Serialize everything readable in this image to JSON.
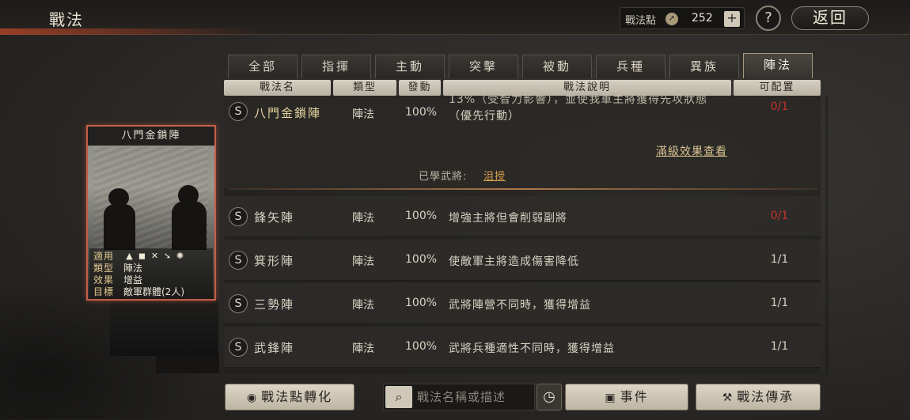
{
  "header": {
    "title": "戰法",
    "points_label": "戰法點",
    "points_value": "252",
    "plus_label": "+",
    "help_label": "?",
    "back_label": "返回"
  },
  "tabs": [
    {
      "label": "全部",
      "active": false
    },
    {
      "label": "指揮",
      "active": false
    },
    {
      "label": "主動",
      "active": false
    },
    {
      "label": "突擊",
      "active": false
    },
    {
      "label": "被動",
      "active": false
    },
    {
      "label": "兵種",
      "active": false
    },
    {
      "label": "異族",
      "active": false
    },
    {
      "label": "陣法",
      "active": true
    }
  ],
  "columns": {
    "name": "戰法名",
    "type": "類型",
    "rate": "發動",
    "desc": "戰法說明",
    "config": "可配置"
  },
  "selected": {
    "badge": "S",
    "name": "八門金鎖陣",
    "type": "陣法",
    "rate": "100%",
    "desc_partial": "13%（受智力影響），並使我軍主將獲得先攻狀態",
    "desc_line2": "（優先行動）",
    "config": "0/1",
    "detail_link": "滿級效果查看",
    "learned_label": "已學武將:",
    "learned_name": "沮授"
  },
  "rows": [
    {
      "badge": "S",
      "name": "鋒矢陣",
      "type": "陣法",
      "rate": "100%",
      "desc": "增強主將但會削弱副將",
      "config": "0/1",
      "config_state": "full"
    },
    {
      "badge": "S",
      "name": "箕形陣",
      "type": "陣法",
      "rate": "100%",
      "desc": "使敵軍主將造成傷害降低",
      "config": "1/1",
      "config_state": "ok"
    },
    {
      "badge": "S",
      "name": "三勢陣",
      "type": "陣法",
      "rate": "100%",
      "desc": "武將陣營不同時，獲得增益",
      "config": "1/1",
      "config_state": "ok"
    },
    {
      "badge": "S",
      "name": "武鋒陣",
      "type": "陣法",
      "rate": "100%",
      "desc": "武將兵種適性不同時，獲得增益",
      "config": "1/1",
      "config_state": "ok"
    }
  ],
  "card": {
    "title": "八門金鎖陣",
    "applies_key": "適用",
    "applies_icons": [
      "shield-icon",
      "crossbow-icon",
      "spear-icon",
      "cavalry-icon",
      "siege-icon"
    ],
    "type_key": "類型",
    "type_val": "陣法",
    "effect_key": "效果",
    "effect_val": "增益",
    "target_key": "目標",
    "target_val": "敵軍群體(2人)"
  },
  "bottom": {
    "convert_label": "戰法點轉化",
    "search_placeholder": "戰法名稱或描述",
    "events_label": "事件",
    "inherit_label": "戰法傳承"
  },
  "colors": {
    "accent_red": "#c8322a",
    "gold": "#e8d4a0",
    "link": "#d8a050"
  }
}
